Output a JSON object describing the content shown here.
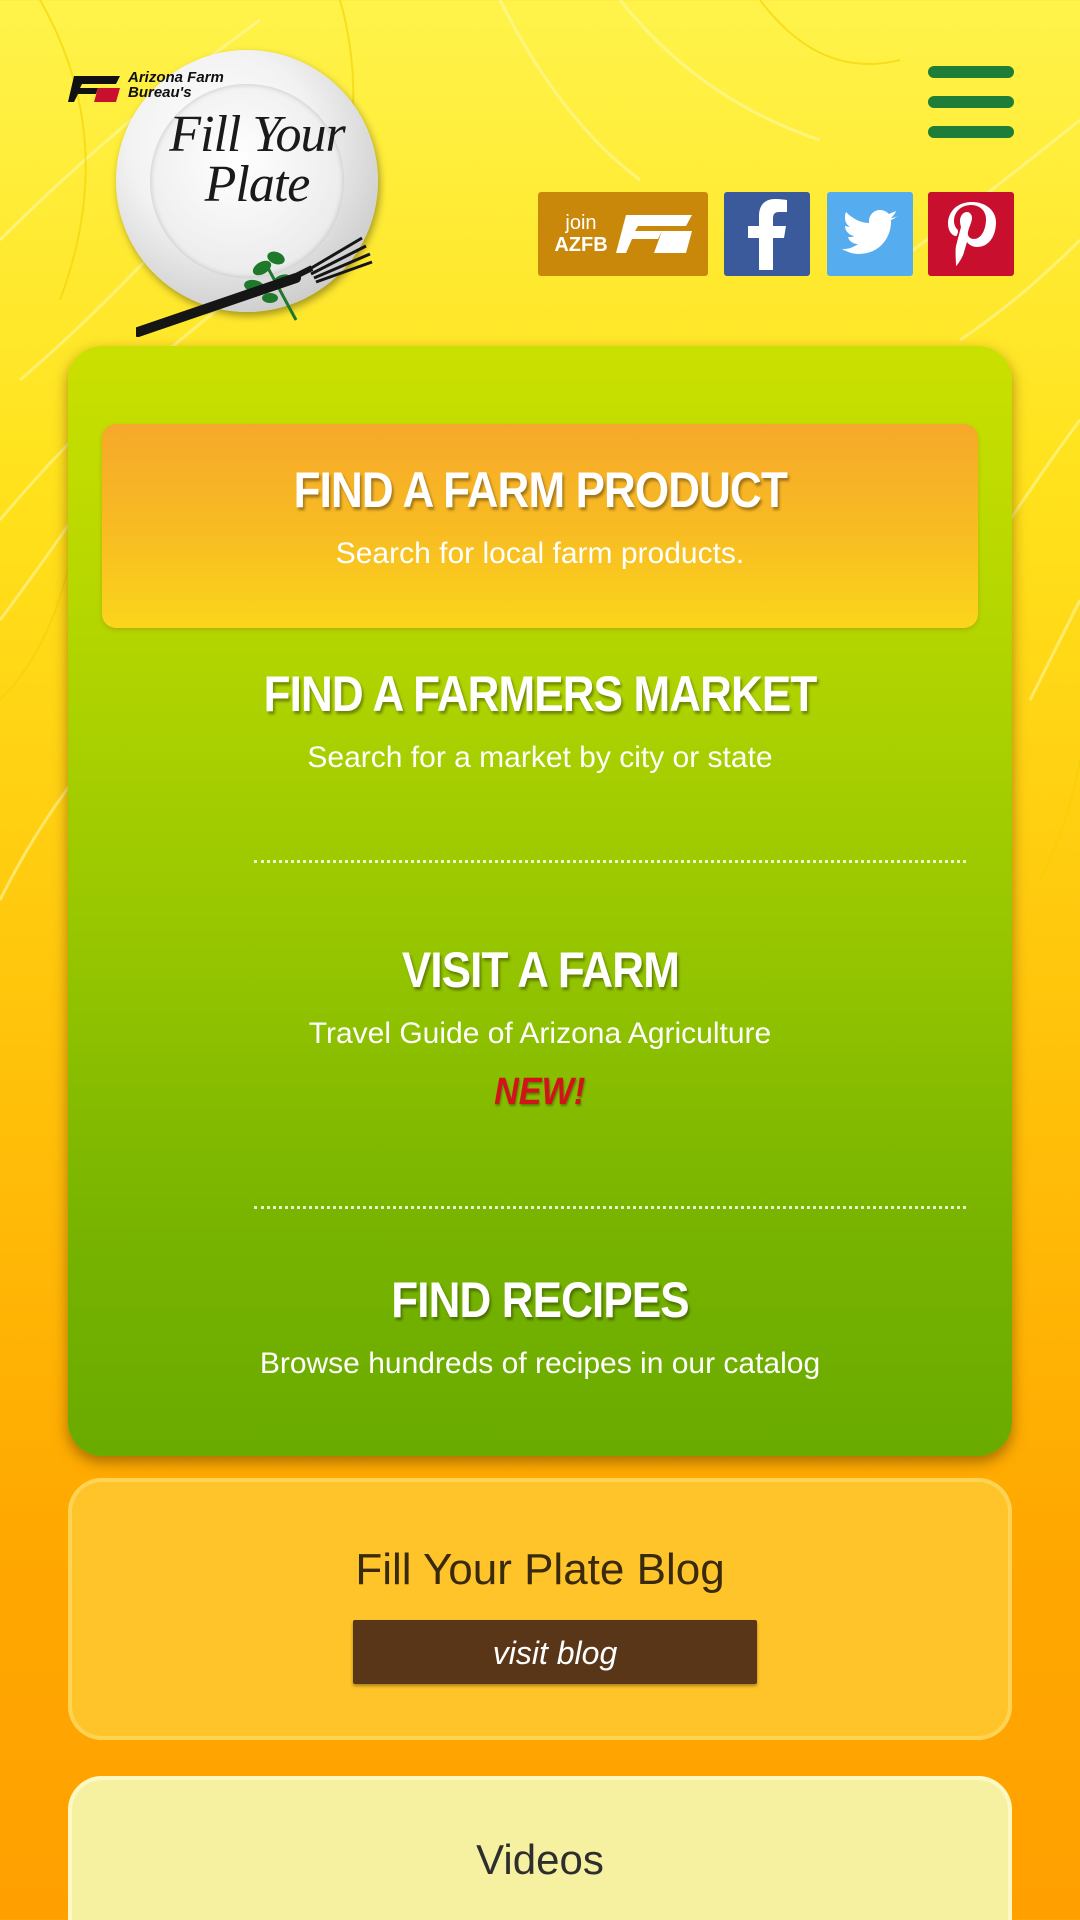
{
  "header": {
    "logo_org": "Arizona Farm Bureau's",
    "logo_title_line1": "Fill Your",
    "logo_title_line2": "Plate",
    "menu_icon": "hamburger-menu-icon",
    "social": {
      "join_line1": "join",
      "join_line2": "AZFB",
      "facebook_icon": "facebook-icon",
      "twitter_icon": "twitter-icon",
      "pinterest_icon": "pinterest-icon"
    }
  },
  "main": {
    "farm_product": {
      "title": "FIND A FARM PRODUCT",
      "subtitle": "Search for local farm products."
    },
    "farmers_market": {
      "title": "FIND A FARMERS MARKET",
      "subtitle": "Search for a market by city or state"
    },
    "visit_farm": {
      "title": "VISIT A FARM",
      "subtitle": "Travel Guide of Arizona Agriculture",
      "badge": "NEW!"
    },
    "recipes": {
      "title": "FIND RECIPES",
      "subtitle": "Browse hundreds of recipes in our catalog"
    }
  },
  "blog": {
    "title": "Fill Your Plate Blog",
    "button_label": "visit blog"
  },
  "videos": {
    "title": "Videos"
  },
  "colors": {
    "main_card_top": "#cae000",
    "main_card_bottom": "#6aab00",
    "product_box": "#f8bd22",
    "blog_card": "#ffc42a",
    "blog_button": "#5a3618",
    "videos_card": "#f6f1a0",
    "menu_green": "#1e7d36",
    "new_badge_red": "#d1141b"
  }
}
